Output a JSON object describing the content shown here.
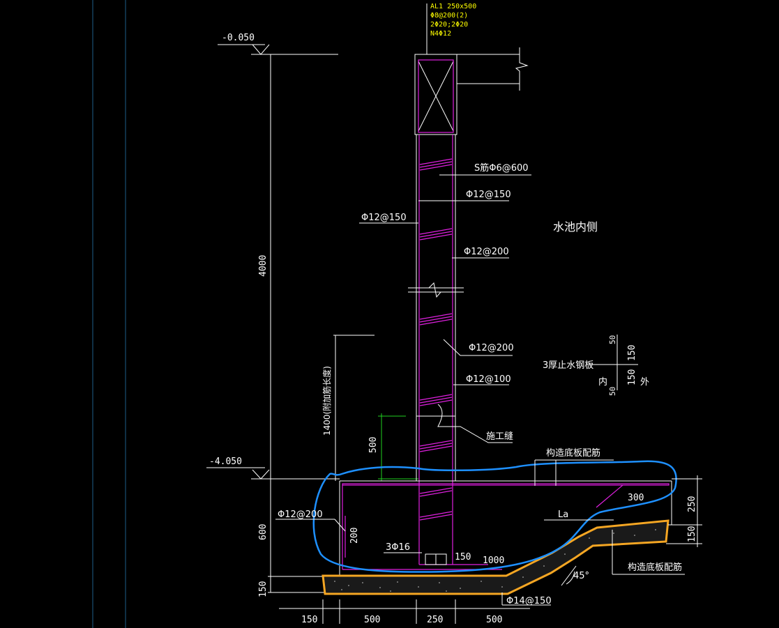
{
  "beam": {
    "line1": "AL1 250x500",
    "line2": "Φ8@200(2)",
    "line3": "2Φ20;2Φ20",
    "line4": "N4Φ12"
  },
  "elevations": {
    "top": "-0.050",
    "bottom": "-4.050"
  },
  "dimensions": {
    "wall_height": "4000",
    "anchor_length": "1400(附加筋长度)",
    "construction_joint_offset": "500",
    "footing_height": "600",
    "cushion_thickness": "150",
    "bottom_150": "150",
    "bottom_500a": "500",
    "bottom_250": "250",
    "bottom_500b": "500",
    "right_250": "250",
    "right_150": "150",
    "inner_200": "200",
    "inner_150": "150",
    "inner_1000": "1000",
    "inner_300": "300",
    "la": "La",
    "angle": "45°"
  },
  "rebar_labels": {
    "s_tie": "S筋Φ6@600",
    "r1": "Φ12@150",
    "r2": "Φ12@200",
    "left_wall": "Φ12@150",
    "r3": "Φ12@200",
    "r4": "Φ12@100",
    "footing_left": "Φ12@200",
    "three_bars": "3Φ16",
    "bottom_bar": "Φ14@150"
  },
  "notes": {
    "pool_inside": "水池内侧",
    "waterstop": "3厚止水钢板",
    "construction_joint": "施工缝",
    "detail_inner": "内",
    "detail_outer": "外",
    "detail_150a": "150",
    "detail_150b": "150",
    "detail_50a": "50",
    "detail_50b": "50",
    "constr_bottom_top": "构造底板配筋",
    "constr_bottom_bot": "构造底板配筋"
  },
  "colors": {
    "background": "#000000",
    "rebar": "#e020e0",
    "beam_text": "#ffff00",
    "blue_markup": "#1e90ff",
    "orange_markup": "#f5a623",
    "dim_green": "#20d020"
  }
}
